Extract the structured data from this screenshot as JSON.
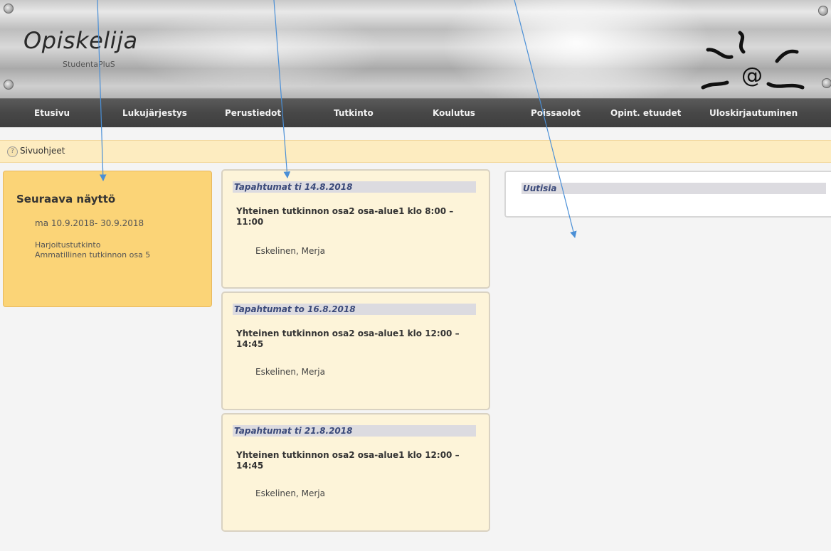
{
  "header": {
    "app_title": "Opiskelija",
    "app_subtitle": "StudentaPluS",
    "logo_icon": "sun-at-logo-icon"
  },
  "nav": {
    "items": [
      {
        "label": "Etusivu"
      },
      {
        "label": "Lukujärjestys"
      },
      {
        "label": "Perustiedot"
      },
      {
        "label": "Tutkinto"
      },
      {
        "label": "Koulutus"
      },
      {
        "label": "Poissaolot"
      },
      {
        "label": "Opint. etuudet"
      },
      {
        "label": "Uloskirjautuminen"
      }
    ]
  },
  "help": {
    "label": "Sivuohjeet",
    "icon": "help-icon"
  },
  "next_exam": {
    "title": "Seuraava näyttö",
    "dates": "ma 10.9.2018- 30.9.2018",
    "line1": "Harjoitustutkinto",
    "line2": "Ammatillinen tutkinnon osa 5"
  },
  "events": [
    {
      "heading": "Tapahtumat ti 14.8.2018",
      "title": "Yhteinen tutkinnon osa2 osa-alue1 klo 8:00 – 11:00",
      "person": "Eskelinen, Merja"
    },
    {
      "heading": "Tapahtumat to 16.8.2018",
      "title": "Yhteinen tutkinnon osa2 osa-alue1 klo 12:00 – 14:45",
      "person": "Eskelinen, Merja"
    },
    {
      "heading": "Tapahtumat ti 21.8.2018",
      "title": "Yhteinen tutkinnon osa2 osa-alue1 klo 12:00 – 14:45",
      "person": "Eskelinen, Merja"
    }
  ],
  "news": {
    "heading": "Uutisia"
  },
  "colors": {
    "annotation_arrow": "#4a8fd6",
    "panel_yellow": "#fbd477",
    "card_cream": "#fdf4d9",
    "navbar": "#474747"
  }
}
